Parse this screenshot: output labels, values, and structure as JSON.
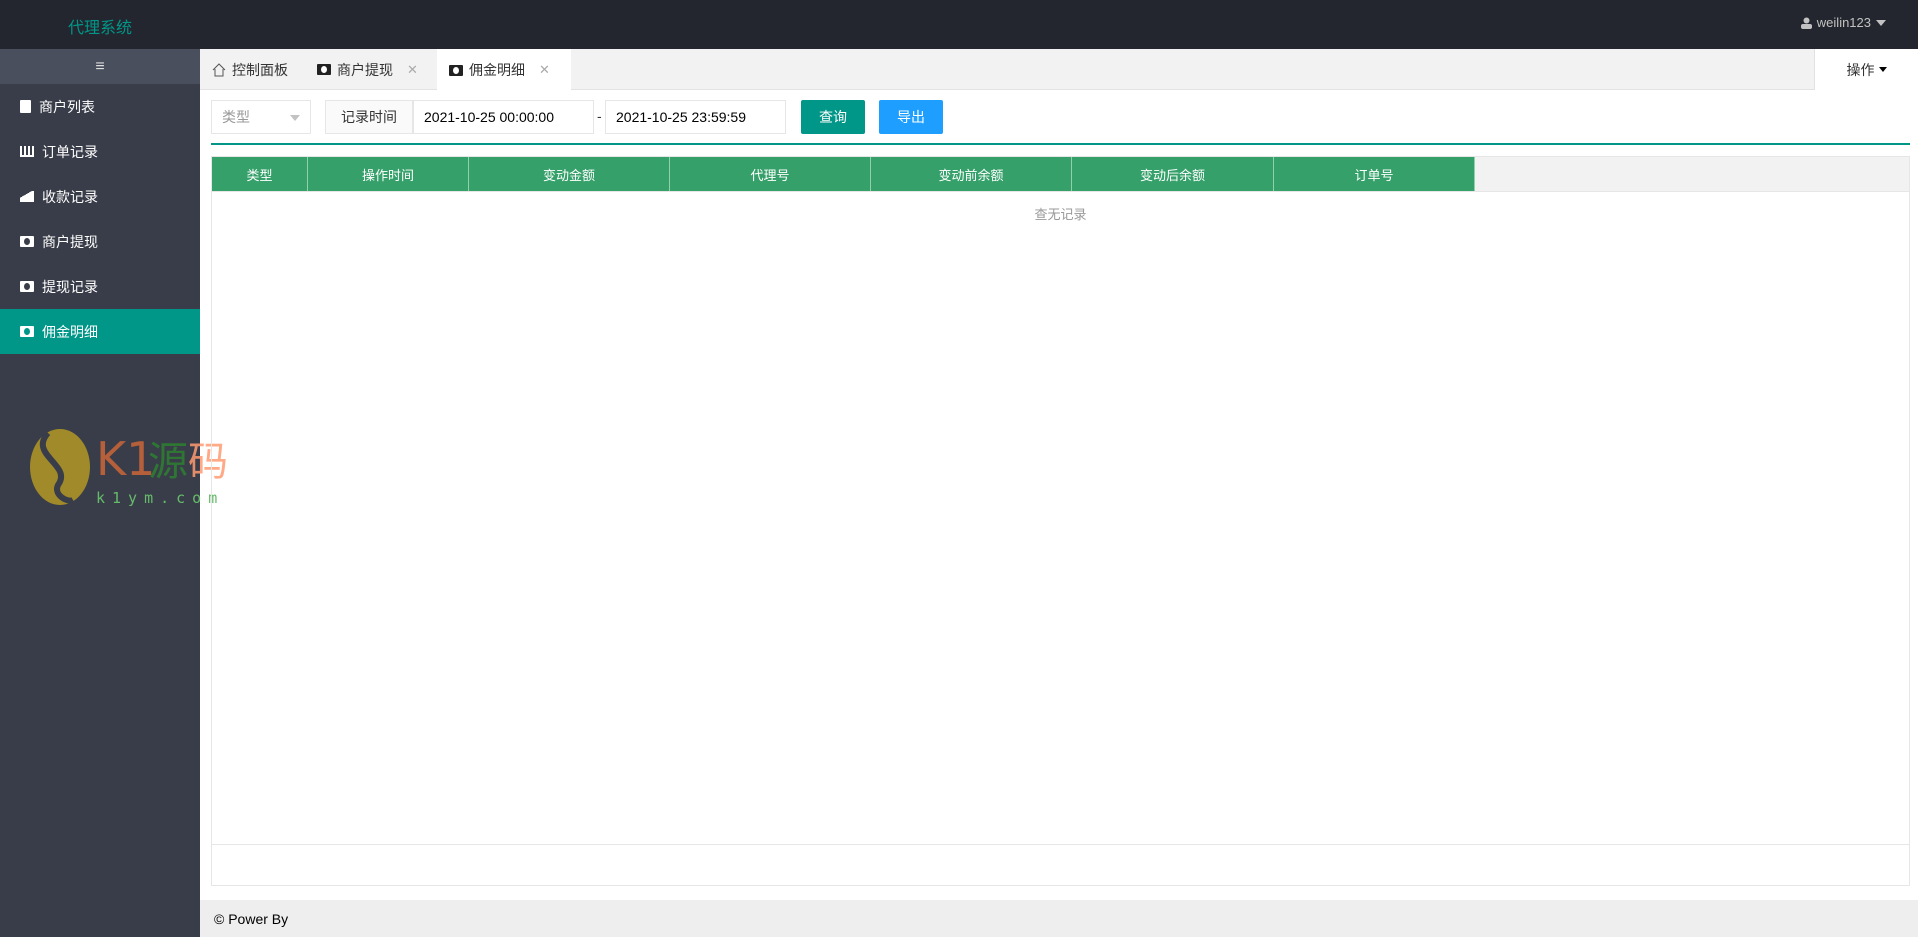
{
  "header": {
    "title": "代理系统",
    "user": "weilin123"
  },
  "sidebar": {
    "toggle_icon": "≡",
    "items": [
      {
        "label": "商户列表",
        "icon": "address-book-icon"
      },
      {
        "label": "订单记录",
        "icon": "bar-chart-icon"
      },
      {
        "label": "收款记录",
        "icon": "area-chart-icon"
      },
      {
        "label": "商户提现",
        "icon": "money-icon"
      },
      {
        "label": "提现记录",
        "icon": "money-icon"
      },
      {
        "label": "佣金明细",
        "icon": "money-icon",
        "active": true
      }
    ]
  },
  "watermark": {
    "brand": "K1源码",
    "domain": "k1ym.com"
  },
  "tabs": [
    {
      "label": "控制面板"
    },
    {
      "label": "商户提现",
      "close": "✕"
    },
    {
      "label": "佣金明细",
      "close": "✕",
      "active": true
    }
  ],
  "ops_label": "操作",
  "filter": {
    "type_placeholder": "类型",
    "time_label": "记录时间",
    "start": "2021-10-25 00:00:00",
    "sep": "-",
    "end": "2021-10-25 23:59:59",
    "query": "查询",
    "export": "导出"
  },
  "table": {
    "columns": [
      "类型",
      "操作时间",
      "变动金额",
      "代理号",
      "变动前余额",
      "变动后余额",
      "订单号"
    ],
    "empty": "查无记录"
  },
  "colors": {
    "accent": "#009688",
    "header_green": "#35a06a",
    "export_blue": "#1e9fff"
  },
  "footer": "© Power By"
}
